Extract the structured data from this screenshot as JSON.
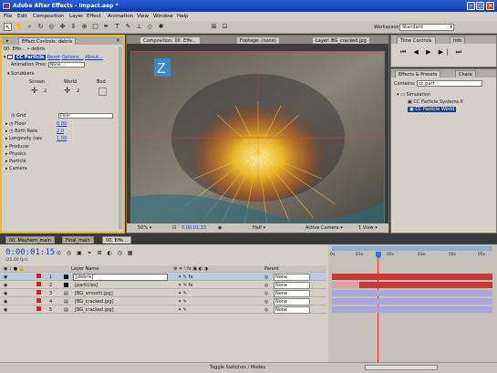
{
  "window": {
    "title": "Adobe After Effects - Impact.aep *"
  },
  "menu": [
    "File",
    "Edit",
    "Composition",
    "Layer",
    "Effect",
    "Animation",
    "View",
    "Window",
    "Help"
  ],
  "workspace": {
    "label": "Workspace:",
    "value": "Standard"
  },
  "effect_controls": {
    "tab": "Effect Controls: debris",
    "breadcrumb": "00. Effe... • debris",
    "effect_name": "CC Particle",
    "reset_label": "Reset",
    "options_label": "Options...",
    "about_label": "About...",
    "animation_presets_label": "Animation Pres:",
    "animation_presets_value": "None",
    "scrubbers_label": "Scrubbers",
    "scrub_headers": [
      "Screen",
      "World",
      "Bod"
    ],
    "scrub_values": [
      "2",
      "2"
    ],
    "grid_label": "Grid",
    "grid_value": "Floor",
    "floor_label": "Floor",
    "floor_value": "0.00",
    "birth_rate_label": "Birth Rate",
    "birth_rate_value": "2.0",
    "longevity_label": "Longevity (sec",
    "longevity_value": "1.00",
    "groups": [
      "Producer",
      "Physics",
      "Particle",
      "Camera"
    ]
  },
  "composition": {
    "tabs": [
      "Composition: 00. Effe...",
      "Footage: (none)",
      "Layer: BG_cracked.jpg"
    ],
    "zoom": "50%",
    "timecode": "0:00:01:15",
    "resolution": "Half",
    "camera": "Active Camera",
    "views": "1 View",
    "logo_letter": "Z"
  },
  "time_controls": {
    "tab": "Time Controls",
    "tab2": "Info"
  },
  "effects_presets": {
    "tab": "Effects & Presets",
    "tab2": "Chara",
    "contains_label": "Contains:",
    "contains_value": "cc part",
    "folder": "Simulation",
    "items": [
      "CC Particle Systems II",
      "CC Particle World"
    ]
  },
  "timeline_tabs": [
    "00. Mayhem_main",
    "Final_main",
    "00. Effe..."
  ],
  "timeline": {
    "current_time": "0:00:01:15",
    "fps": "(25.00 fps)",
    "columns": {
      "name": "Layer Name",
      "parent": "Parent"
    },
    "layers": [
      {
        "num": "1",
        "name": "[debris]",
        "parent": "None",
        "color": "#d02020"
      },
      {
        "num": "2",
        "name": "[particles]",
        "parent": "None",
        "color": "#d02020"
      },
      {
        "num": "3",
        "name": "[BG_smooth.jpg]",
        "parent": "None",
        "color": "#a0a0d8"
      },
      {
        "num": "4",
        "name": "[BG_cracked.jpg]",
        "parent": "None",
        "color": "#a0a0d8"
      },
      {
        "num": "5",
        "name": "[BG_cracked.jpg]",
        "parent": "None",
        "color": "#a0a0d8"
      }
    ],
    "ruler": [
      "0s",
      "01s",
      "02s",
      "03s",
      "04s",
      "05s"
    ],
    "footer": "Toggle Switches / Modes"
  }
}
